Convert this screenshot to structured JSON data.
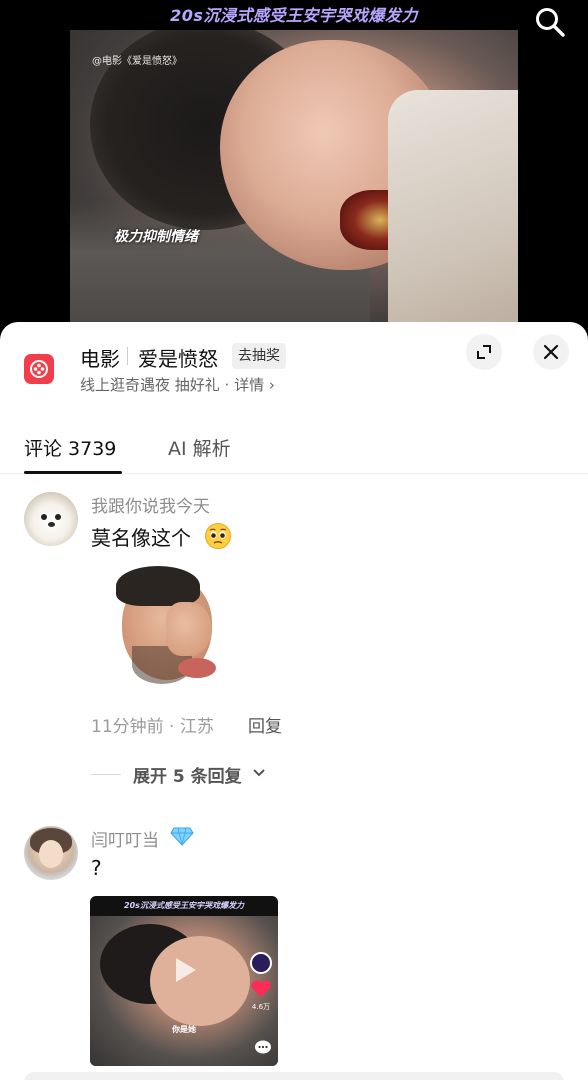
{
  "video": {
    "title": "20s沉浸式感受王安宇哭戏爆发力",
    "watermark": "@电影《爱是愤怒》",
    "caption": "极力抑制情绪"
  },
  "movie_card": {
    "type": "电影",
    "name": "爱是愤怒",
    "tag": "去抽奖",
    "subtitle": "线上逛奇遇夜 抽好礼 · 详情 ›",
    "logo_color": "#f23e4a"
  },
  "tabs": {
    "comments_label": "评论 3739",
    "ai_label": "AI 解析"
  },
  "comments": [
    {
      "username": "我跟你说我今天",
      "text": "莫名像这个",
      "emoji": "pleading-face-icon",
      "meta": "11分钟前 · 江苏",
      "reply_label": "回复",
      "expand_label": "展开 5 条回复"
    },
    {
      "username": "闫叮叮当",
      "badge": "diamond-icon",
      "text": "?",
      "thumb_title": "20s沉浸式感受王安宇哭戏爆发力",
      "thumb_caption": "你是她",
      "thumb_likes": "4.6万"
    }
  ]
}
